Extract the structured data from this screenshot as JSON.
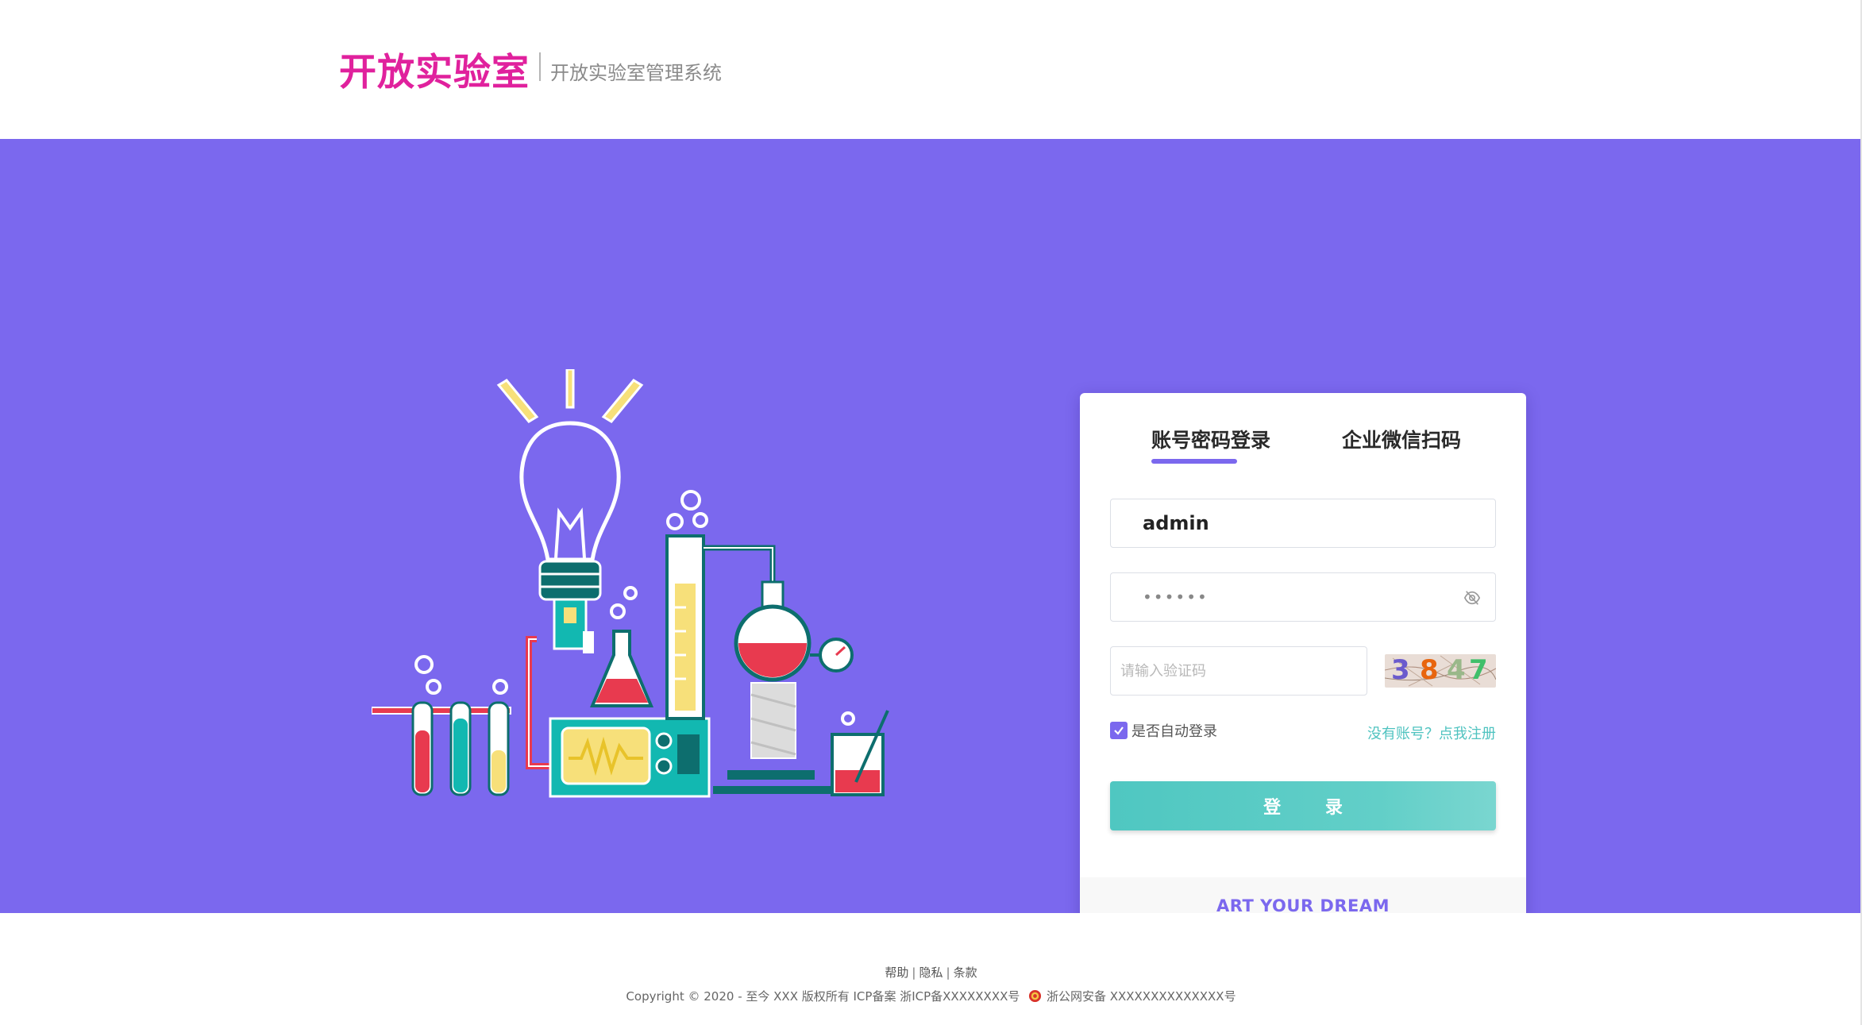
{
  "header": {
    "brand_title": "开放实验室",
    "brand_subtitle": "开放实验室管理系统"
  },
  "login_card": {
    "tabs": [
      {
        "label": "账号密码登录",
        "active": true
      },
      {
        "label": "企业微信扫码",
        "active": false
      }
    ],
    "username": {
      "value": "admin"
    },
    "password": {
      "value": "••••••"
    },
    "captcha": {
      "placeholder": "请输入验证码",
      "chars": [
        {
          "char": "3",
          "color": "#6a5acd"
        },
        {
          "char": "8",
          "color": "#e8650e"
        },
        {
          "char": "4",
          "color": "#9ab88a"
        },
        {
          "char": "7",
          "color": "#3fbf6a"
        }
      ]
    },
    "remember_label": "是否自动登录",
    "remember_checked": true,
    "register_link": "没有账号？点我注册",
    "login_button": "登 录",
    "slogan": "ART YOUR DREAM"
  },
  "footer": {
    "links": [
      "帮助",
      "隐私",
      "条款"
    ],
    "link_separator": "|",
    "copyright": "Copyright © 2020 - 至今 XXX 版权所有 ICP备案 浙ICP备XXXXXXXX号",
    "police_record": "浙公网安备 XXXXXXXXXXXXXX号"
  },
  "colors": {
    "brand": "#e0219d",
    "hero_background": "#7b68ee",
    "accent": "#7b68ee",
    "button": "#5ccac4",
    "link": "#4fc3c0"
  }
}
